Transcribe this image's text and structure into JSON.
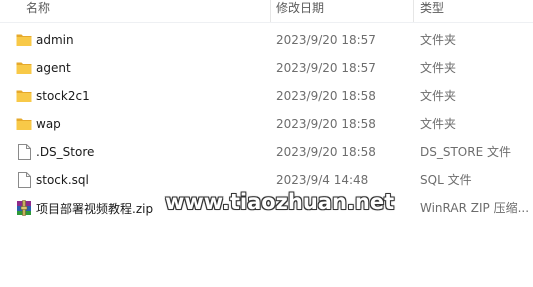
{
  "columns": {
    "name": "名称",
    "modified": "修改日期",
    "type": "类型"
  },
  "files": [
    {
      "name": "admin",
      "modified": "2023/9/20 18:57",
      "type": "文件夹",
      "icon": "folder-icon"
    },
    {
      "name": "agent",
      "modified": "2023/9/20 18:57",
      "type": "文件夹",
      "icon": "folder-icon"
    },
    {
      "name": "stock2c1",
      "modified": "2023/9/20 18:58",
      "type": "文件夹",
      "icon": "folder-icon"
    },
    {
      "name": "wap",
      "modified": "2023/9/20 18:58",
      "type": "文件夹",
      "icon": "folder-icon"
    },
    {
      "name": ".DS_Store",
      "modified": "2023/9/20 18:58",
      "type": "DS_STORE 文件",
      "icon": "file-icon"
    },
    {
      "name": "stock.sql",
      "modified": "2023/9/4 14:48",
      "type": "SQL 文件",
      "icon": "file-icon"
    },
    {
      "name": "项目部署视频教程.zip",
      "modified": "",
      "type": "WinRAR ZIP 压缩...",
      "icon": "winrar-archive-icon"
    }
  ],
  "watermark": "www.tiaozhuan.net",
  "colors": {
    "folder": "#f8c948",
    "folder_dark": "#e6a92b"
  }
}
